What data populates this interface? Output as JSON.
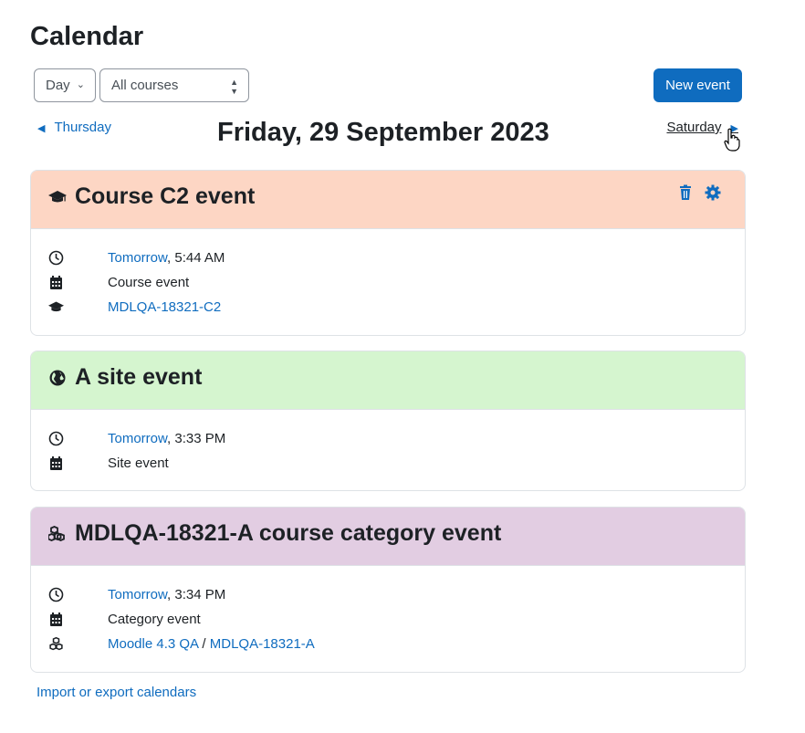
{
  "page": {
    "title": "Calendar"
  },
  "toolbar": {
    "view_select": "Day",
    "course_select": "All courses",
    "new_event_label": "New event"
  },
  "daynav": {
    "prev_label": "Thursday",
    "current_date": "Friday, 29 September 2023",
    "next_label": "Saturday"
  },
  "events": [
    {
      "title": "Course C2 event",
      "header_color": "#fdd6c4",
      "time_link": "Tomorrow",
      "time_rest": ", 5:44 AM",
      "type": "Course event",
      "course_link": "MDLQA-18321-C2"
    },
    {
      "title": "A site event",
      "header_color": "#d5f5cf",
      "time_link": "Tomorrow",
      "time_rest": ", 3:33 PM",
      "type": "Site event"
    },
    {
      "title": "MDLQA-18321-A course category event",
      "header_color": "#e2cde2",
      "time_link": "Tomorrow",
      "time_rest": ", 3:34 PM",
      "type": "Category event",
      "category_link_1": "Moodle 4.3 QA",
      "category_sep": " / ",
      "category_link_2": "MDLQA-18321-A"
    }
  ],
  "footer": {
    "import_export_label": "Import or export calendars"
  },
  "colors": {
    "accent": "#0f6cbf",
    "border": "#dee2e6"
  }
}
